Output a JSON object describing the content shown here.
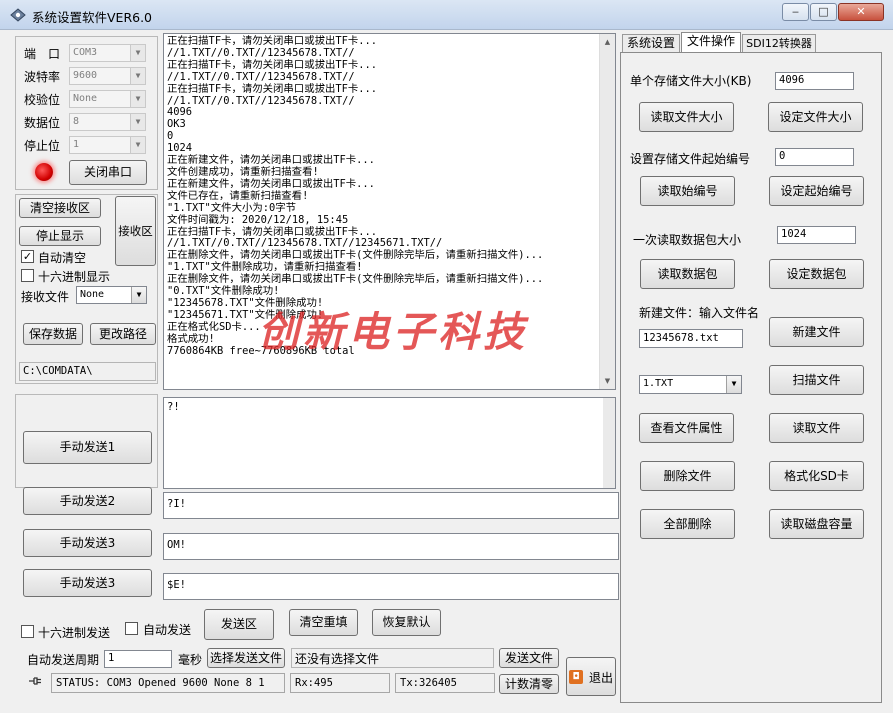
{
  "window": {
    "title": "系统设置软件VER6.0",
    "minimize": "‒",
    "maximize": "□",
    "close": "✕"
  },
  "serial": {
    "port_label": "端　口",
    "port_value": "COM3",
    "baud_label": "波特率",
    "baud_value": "9600",
    "parity_label": "校验位",
    "parity_value": "None",
    "databits_label": "数据位",
    "databits_value": "8",
    "stopbits_label": "停止位",
    "stopbits_value": "1",
    "close_port_button": "关闭串口"
  },
  "receive": {
    "clear_button": "清空接收区",
    "stop_button": "停止显示",
    "area_label": "接收区",
    "auto_clear_label": "自动清空",
    "auto_clear_checked": true,
    "hex_label": "十六进制显示",
    "hex_checked": false,
    "file_label": "接收文件",
    "file_value": "None",
    "save_button": "保存数据",
    "change_path_button": "更改路径",
    "path": "C:\\COMDATA\\",
    "lines": [
      "正在扫描TF卡，请勿关闭串口或拔出TF卡...",
      "//1.TXT//0.TXT//12345678.TXT//",
      "正在扫描TF卡，请勿关闭串口或拔出TF卡...",
      "//1.TXT//0.TXT//12345678.TXT//",
      "正在扫描TF卡，请勿关闭串口或拔出TF卡...",
      "//1.TXT//0.TXT//12345678.TXT//",
      "4096",
      "OK3",
      "0",
      "1024",
      "正在新建文件，请勿关闭串口或拔出TF卡...",
      "文件创建成功，请重新扫描查看!",
      "正在新建文件，请勿关闭串口或拔出TF卡...",
      "文件已存在，请重新扫描查看!",
      "\"1.TXT\"文件大小为:0字节",
      "文件时间戳为: 2020/12/18, 15:45",
      "正在扫描TF卡，请勿关闭串口或拔出TF卡...",
      "//1.TXT//0.TXT//12345678.TXT//12345671.TXT//",
      "正在删除文件，请勿关闭串口或拔出TF卡(文件删除完毕后，请重新扫描文件)...",
      "\"1.TXT\"文件删除成功，请重新扫描查看!",
      "正在删除文件，请勿关闭串口或拔出TF卡(文件删除完毕后，请重新扫描文件)...",
      "\"0.TXT\"文件删除成功!",
      "\"12345678.TXT\"文件删除成功!",
      "\"12345671.TXT\"文件删除成功!",
      "正在格式化SD卡...",
      "格式成功!",
      "7760864KB free~7760896KB total"
    ],
    "watermark": "创新电子科技"
  },
  "send": {
    "btn1": "手动发送1",
    "btn2": "手动发送2",
    "btn3": "手动发送3",
    "btn4": "手动发送3",
    "text1": "?!",
    "text2": "?I!",
    "text3": "OM!",
    "text4": "$E!",
    "hex_send_label": "十六进制发送",
    "hex_send_checked": false,
    "auto_send_label": "自动发送",
    "auto_send_checked": false,
    "send_area_button": "发送区",
    "clear_redo_button": "清空重填",
    "restore_default_button": "恢复默认",
    "period_label": "自动发送周期",
    "period_value": "1",
    "ms_label": "毫秒",
    "choose_file_button": "选择发送文件",
    "file_status": "还没有选择文件",
    "send_file_button": "发送文件",
    "reset_count_button": "计数清零",
    "exit_button": "退出"
  },
  "status": {
    "text": "STATUS: COM3 Opened 9600 None 8 1",
    "rx": "Rx:495",
    "tx": "Tx:326405"
  },
  "tabs": [
    "系统设置",
    "文件操作",
    "SDI12转换器"
  ],
  "file_ops": {
    "single_size_label": "单个存储文件大小(KB)",
    "single_size_value": "4096",
    "read_size_button": "读取文件大小",
    "set_size_button": "设定文件大小",
    "start_num_label": "设置存储文件起始编号",
    "start_num_value": "0",
    "read_start_button": "读取始编号",
    "set_start_button": "设定起始编号",
    "packet_label": "一次读取数据包大小",
    "packet_value": "1024",
    "read_packet_button": "读取数据包",
    "set_packet_button": "设定数据包",
    "new_file_label": "新建文件：输入文件名",
    "new_file_value": "12345678.txt",
    "new_file_button": "新建文件",
    "file_select_value": "1.TXT",
    "scan_button": "扫描文件",
    "props_button": "查看文件属性",
    "read_file_button": "读取文件",
    "delete_button": "删除文件",
    "format_button": "格式化SD卡",
    "delete_all_button": "全部删除",
    "read_capacity_button": "读取磁盘容量"
  },
  "colors": {
    "watermark": "#dc2828",
    "led": "#e00000",
    "title_bar": "#c9d9ee"
  }
}
